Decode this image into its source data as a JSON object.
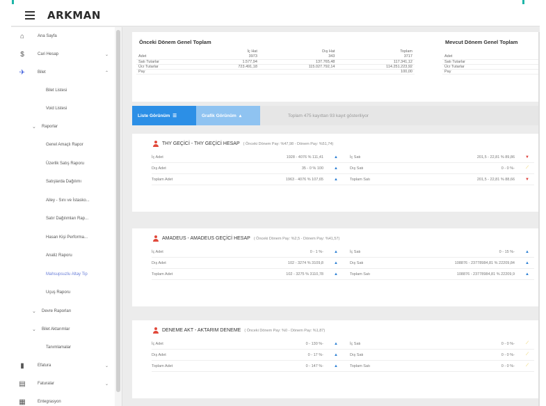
{
  "app": {
    "brand": "ARKMAN"
  },
  "sidebar": {
    "items": [
      {
        "label": "Ana Sayfa",
        "icon": "home-icon"
      },
      {
        "label": "Cari Hesap",
        "icon": "dollar-icon",
        "chevron": "⌄"
      },
      {
        "label": "Bilet",
        "icon": "plane-icon",
        "chevron": "⌃"
      }
    ],
    "bilet_sub": [
      "Bilet Listesi",
      "Void Listesi"
    ],
    "raporlar": {
      "bullet": "⌄",
      "label": "Raporlar"
    },
    "rapor_items": [
      "Genel Amaçlı Rapor",
      "Üzerlik Satış Raporu",
      "Satışlarda Dağılımı",
      "Ailey - Sını ve İstasko...",
      "Satır Dağılımları Rap...",
      "Hasan Kişi Performa...",
      "Analiz Raporu",
      "Mahsupsuzlu Altay Tip",
      "Uçuş Raporu"
    ],
    "extra_groups": [
      {
        "bullet": "⌄",
        "label": "Devre Raporları"
      },
      {
        "bullet": "⌄",
        "label": "Bilet Aktarımlar"
      }
    ],
    "tanimlamalar": "Tanımlamalar",
    "bottom_items": [
      {
        "label": "Efatura",
        "icon": "book-icon",
        "chevron": "⌄"
      },
      {
        "label": "Faturalar",
        "icon": "invoice-icon",
        "chevron": "⌄"
      },
      {
        "label": "Entegrasyon",
        "icon": "grid-icon"
      }
    ]
  },
  "summary": {
    "left": {
      "title": "Önceki Dönem Genel Toplam",
      "headers": [
        "",
        "İç Hat",
        "Dış Hat",
        "Toplam"
      ],
      "rows": [
        [
          "Adet",
          "3973",
          "343",
          "3717"
        ],
        [
          "Satı Tutarlar",
          "1.577,94",
          "137.765,48",
          "117.341,12"
        ],
        [
          "Ücr Tutarlar",
          "723.491,18",
          "115.027.792,14",
          "114.251.223,92"
        ],
        [
          "Pay",
          "",
          "",
          "100,00"
        ]
      ]
    },
    "right": {
      "title": "Mevcut Dönem Genel Toplam",
      "rows": [
        "Adet",
        "Satı Tutarlar",
        "Ücr Tutarlar",
        "Pay"
      ]
    }
  },
  "tabs": {
    "list": "Liste Görünüm",
    "list_icon": "☰",
    "graph": "Grafik Görünüm",
    "graph_icon": "▴",
    "info": "Toplam 475 kayıttan 93 kayıt gösteriliyor"
  },
  "cards": [
    {
      "name": "THY GEÇİCİ - THY GEÇİCİ HESAP",
      "sub": "( Önceki Dönem Pay: %47,98 - Dönem Pay: %51,74)",
      "rows": [
        {
          "l1": "İç Adet",
          "v1": "1928 - 4076  % 111,41",
          "a1": "▲",
          "c1": "up",
          "l2": "İç Satı",
          "v2": "201,5 - 22,81  % 89,86",
          "a2": "▼",
          "c2": "down"
        },
        {
          "l1": "Dış Adet",
          "v1": "35 - 0  % 100",
          "a1": "▲",
          "c1": "up",
          "l2": "Dış Satı",
          "v2": "0 - 0  %-",
          "a2": "⟋",
          "c2": "flat"
        },
        {
          "l1": "Toplam Adet",
          "v1": "1963 - 4076  % 107,65",
          "a1": "▲",
          "c1": "up",
          "l2": "Toplam Satı",
          "v2": "201,5 - 22,81  % 88,66",
          "a2": "▼",
          "c2": "down"
        }
      ]
    },
    {
      "name": "AMADEUS - AMADEUS GEÇİCİ HESAP",
      "sub": "( Önceki Dönem Pay: %2,5 - Dönem Pay: %41,57)",
      "rows": [
        {
          "l1": "İç Adet",
          "v1": "0 - 1  %-",
          "a1": "▲",
          "c1": "up",
          "l2": "İç Satı",
          "v2": "0 - 15  %-",
          "a2": "▲",
          "c2": "up"
        },
        {
          "l1": "Dış Adet",
          "v1": "102 - 3274  % 3109,8",
          "a1": "▲",
          "c1": "up",
          "l2": "Dış Satı",
          "v2": "108876 - 23778984,81  % 22209,84",
          "a2": "▲",
          "c2": "up"
        },
        {
          "l1": "Toplam Adet",
          "v1": "102 - 3275  % 3110,78",
          "a1": "▲",
          "c1": "up",
          "l2": "Toplam Satı",
          "v2": "108876 - 23778984,81  % 22209,9",
          "a2": "▲",
          "c2": "up"
        }
      ]
    },
    {
      "name": "DENEME AKT - AKTARIM DENEME",
      "sub": "( Önceki Dönem Pay: %0 - Dönem Pay: %1,87)",
      "rows": [
        {
          "l1": "İç Adet",
          "v1": "0 - 130  %-",
          "a1": "▲",
          "c1": "up",
          "l2": "İç Satı",
          "v2": "0 - 0  %-",
          "a2": "⟋",
          "c2": "flat"
        },
        {
          "l1": "Dış Adet",
          "v1": "0 - 17  %-",
          "a1": "▲",
          "c1": "up",
          "l2": "Dış Satı",
          "v2": "0 - 0  %-",
          "a2": "⟋",
          "c2": "flat"
        },
        {
          "l1": "Toplam Adet",
          "v1": "0 - 147  %-",
          "a1": "▲",
          "c1": "up",
          "l2": "Toplam Satı",
          "v2": "0 - 0  %-",
          "a2": "⟋",
          "c2": "flat"
        }
      ]
    }
  ]
}
